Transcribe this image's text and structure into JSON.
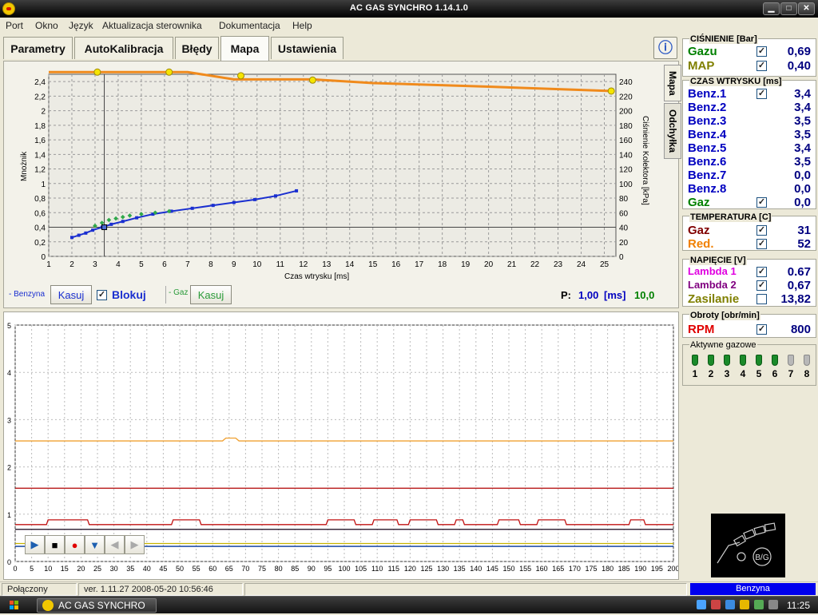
{
  "window": {
    "title": "AC GAS SYNCHRO    1.14.1.0",
    "min": "▁",
    "max": "□",
    "close": "✕"
  },
  "menu": [
    "Port",
    "Okno",
    "Język",
    "Aktualizacja sterownika",
    "Dokumentacja",
    "Help"
  ],
  "tabs": [
    {
      "label": "Parametry"
    },
    {
      "label": "AutoKalibracja"
    },
    {
      "label": "Błędy"
    },
    {
      "label": "Mapa",
      "active": true
    },
    {
      "label": "Ustawienia"
    }
  ],
  "help_icon": "info-icon",
  "map": {
    "side_tabs": [
      "Mapa",
      "Odchyłka"
    ],
    "xlabel": "Czas wtrysku [ms]",
    "ylabel_left": "Mnożnik",
    "ylabel_right": "Ciśnienie Kolektora [kPa]",
    "benzyna_label": "- Benzyna",
    "kasuj1": "Kasuj",
    "blokuj": "Blokuj",
    "blokuj_checked": true,
    "gaz_label": "- Gaz",
    "kasuj2": "Kasuj",
    "p_label": "P:",
    "p_value": "1,00",
    "p_unit": "[ms]",
    "p_value2": "10,0"
  },
  "chart_data": [
    {
      "type": "scatter",
      "xlabel": "Czas wtrysku [ms]",
      "ylabel": "Mnożnik",
      "y2label": "Ciśnienie Kolektora [kPa]",
      "xlim": [
        1,
        25.5
      ],
      "ylim": [
        0,
        2.5
      ],
      "y2lim": [
        0,
        250
      ],
      "xticks": [
        1,
        2,
        3,
        4,
        5,
        6,
        7,
        8,
        9,
        10,
        11,
        12,
        13,
        14,
        15,
        16,
        17,
        18,
        19,
        20,
        21,
        22,
        23,
        24,
        25
      ],
      "yticks": [
        "0",
        "0,2",
        "0,4",
        "0,6",
        "0,8",
        "1",
        "1,2",
        "1,4",
        "1,6",
        "1,8",
        "2",
        "2,2",
        "2,4"
      ],
      "y2ticks": [
        0,
        20,
        40,
        60,
        80,
        100,
        120,
        140,
        160,
        180,
        200,
        220,
        240
      ],
      "grid": true,
      "series": [
        {
          "name": "Benzyna",
          "color": "#1a2fd0",
          "points": [
            [
              2.0,
              0.26
            ],
            [
              2.3,
              0.29
            ],
            [
              2.6,
              0.32
            ],
            [
              2.9,
              0.36
            ],
            [
              3.3,
              0.4
            ],
            [
              3.7,
              0.44
            ],
            [
              4.2,
              0.48
            ],
            [
              4.8,
              0.53
            ],
            [
              5.5,
              0.58
            ],
            [
              6.3,
              0.62
            ],
            [
              7.2,
              0.66
            ],
            [
              8.1,
              0.7
            ],
            [
              9.0,
              0.74
            ],
            [
              9.9,
              0.78
            ],
            [
              10.8,
              0.83
            ],
            [
              11.7,
              0.9
            ]
          ]
        },
        {
          "name": "Gaz",
          "color": "#2fa84a",
          "points": [
            [
              3.0,
              0.42
            ],
            [
              3.3,
              0.46
            ],
            [
              3.6,
              0.5
            ],
            [
              3.9,
              0.52
            ],
            [
              4.2,
              0.54
            ],
            [
              4.5,
              0.56
            ],
            [
              5.0,
              0.58
            ],
            [
              5.6,
              0.6
            ],
            [
              6.2,
              0.62
            ]
          ]
        },
        {
          "name": "Ciśnienie",
          "color": "#f08a1c",
          "axis": "right",
          "points": [
            [
              1.0,
              253
            ],
            [
              7.0,
              253
            ],
            [
              9.0,
              243
            ],
            [
              12.4,
              243
            ],
            [
              15,
              238
            ],
            [
              20,
              233
            ],
            [
              24.5,
              228
            ],
            [
              25.3,
              227
            ]
          ]
        }
      ],
      "markers_right_axis": [
        [
          3.1,
          253
        ],
        [
          6.2,
          253
        ],
        [
          9.3,
          248
        ],
        [
          12.4,
          242
        ],
        [
          25.3,
          227
        ]
      ],
      "cursor_x": 3.4,
      "cursor_y": 0.4
    },
    {
      "type": "line",
      "xlim": [
        0,
        200
      ],
      "ylim": [
        0,
        5
      ],
      "xticks": [
        0,
        5,
        10,
        15,
        20,
        25,
        30,
        35,
        40,
        45,
        50,
        55,
        60,
        65,
        70,
        75,
        80,
        85,
        90,
        95,
        100,
        105,
        110,
        115,
        120,
        125,
        130,
        135,
        140,
        145,
        150,
        155,
        160,
        165,
        170,
        175,
        180,
        185,
        190,
        195,
        200
      ],
      "yticks": [
        0,
        1,
        2,
        3,
        4,
        5
      ],
      "grid": true,
      "series": [
        {
          "color": "#f0a030",
          "level": 2.55
        },
        {
          "color": "#b00000",
          "level": 1.55
        },
        {
          "color": "#c01010",
          "level": 0.78
        },
        {
          "color": "#9b2fbf",
          "level": 0.68
        },
        {
          "color": "#222222",
          "level": 0.68
        },
        {
          "color": "#c8b400",
          "level": 0.38
        },
        {
          "color": "#003399",
          "level": 0.32
        }
      ]
    }
  ],
  "playback": [
    {
      "name": "play-icon",
      "glyph": "▶"
    },
    {
      "name": "stop-icon",
      "glyph": "■"
    },
    {
      "name": "record-icon",
      "glyph": "●"
    },
    {
      "name": "down-arrow-icon",
      "glyph": "▼"
    },
    {
      "name": "prev-icon",
      "glyph": "◀"
    },
    {
      "name": "next-icon",
      "glyph": "▶"
    }
  ],
  "pressure": {
    "title": "CIŚNIENIE [Bar]",
    "rows": [
      {
        "name": "Gazu",
        "color": "#008000",
        "value": "0,69"
      },
      {
        "name": "MAP",
        "color": "#808000",
        "value": "0,40"
      }
    ]
  },
  "injection": {
    "title": "CZAS WTRYSKU [ms]",
    "rows": [
      {
        "name": "Benz.1",
        "color": "#0000c0",
        "value": "3,4",
        "check": true
      },
      {
        "name": "Benz.2",
        "color": "#0000c0",
        "value": "3,4",
        "check": false
      },
      {
        "name": "Benz.3",
        "color": "#0000c0",
        "value": "3,5",
        "check": false
      },
      {
        "name": "Benz.4",
        "color": "#0000c0",
        "value": "3,5",
        "check": false
      },
      {
        "name": "Benz.5",
        "color": "#0000c0",
        "value": "3,4",
        "check": false
      },
      {
        "name": "Benz.6",
        "color": "#0000c0",
        "value": "3,5",
        "check": false
      },
      {
        "name": "Benz.7",
        "color": "#0000c0",
        "value": "0,0",
        "check": false
      },
      {
        "name": "Benz.8",
        "color": "#0000c0",
        "value": "0,0",
        "check": false
      },
      {
        "name": "Gaz",
        "color": "#008000",
        "value": "0,0",
        "check": true
      }
    ]
  },
  "temperature": {
    "title": "TEMPERATURA [C]",
    "rows": [
      {
        "name": "Gaz",
        "color": "#800000",
        "value": "31"
      },
      {
        "name": "Red.",
        "color": "#f08000",
        "value": "52"
      }
    ]
  },
  "voltage": {
    "title": "NAPIĘCIE [V]",
    "rows": [
      {
        "name": "Lambda 1",
        "color": "#e000e0",
        "value": "0.67",
        "check": true,
        "size": 13
      },
      {
        "name": "Lambda 2",
        "color": "#800080",
        "value": "0,67",
        "check": true,
        "size": 13
      },
      {
        "name": "Zasilanie",
        "color": "#808000",
        "value": "13,82",
        "check": false,
        "size": 15
      }
    ]
  },
  "rpm": {
    "title": "Obroty [obr/min]",
    "name": "RPM",
    "color": "#e00000",
    "value": "800"
  },
  "active_gas": {
    "title": "Aktywne gazowe",
    "items": [
      {
        "n": "1",
        "on": true
      },
      {
        "n": "2",
        "on": true
      },
      {
        "n": "3",
        "on": true
      },
      {
        "n": "4",
        "on": true
      },
      {
        "n": "5",
        "on": true
      },
      {
        "n": "6",
        "on": true
      },
      {
        "n": "7",
        "on": false
      },
      {
        "n": "8",
        "on": false
      }
    ]
  },
  "logo_text": "B/G",
  "status": {
    "connection": "Połączony",
    "version": "ver. 1.11.27   2008-05-20  10:56:46",
    "fuel": "Benzyna"
  },
  "taskbar": {
    "item": "AC GAS SYNCHRO",
    "clock": "11:25"
  }
}
